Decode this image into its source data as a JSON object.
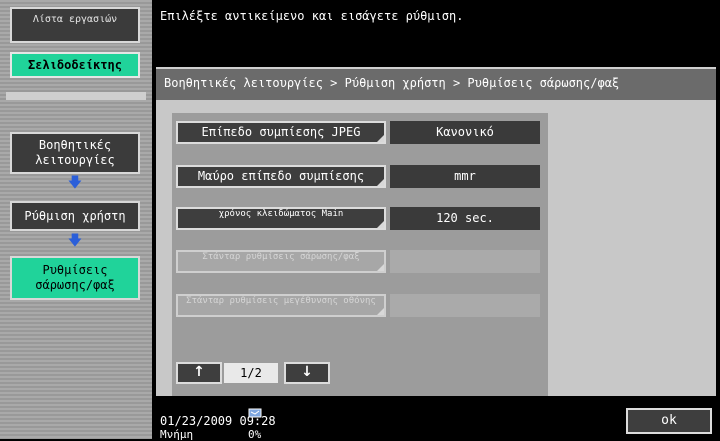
{
  "left_panel": {
    "job_list_label": "Λίστα εργασιών",
    "bookmark_tab": "Σελιδοδείκτης",
    "breadcrumb": [
      {
        "label": "Βοηθητικές λειτουργίες"
      },
      {
        "label": "Ρύθμιση χρήστη"
      },
      {
        "label": "Ρυθμίσεις σάρωσης/φαξ"
      }
    ]
  },
  "header": {
    "message": "Επιλέξτε αντικείμενο και εισάγετε ρύθμιση.",
    "path": "Βοηθητικές λειτουργίες > Ρύθμιση χρήστη > Ρυθμίσεις σάρωσης/φαξ"
  },
  "settings": [
    {
      "label": "Επίπεδο συμπίεσης JPEG",
      "value": "Κανονικό",
      "enabled": true
    },
    {
      "label": "Μαύρο επίπεδο συμπίεσης",
      "value": "mmr",
      "enabled": true
    },
    {
      "label": "χρόνος κλειδώματος Main",
      "value": "120  sec.",
      "enabled": true
    },
    {
      "label": "Στάνταρ ρυθμίσεις σάρωσης/φαξ",
      "value": "",
      "enabled": false
    },
    {
      "label": "Στάνταρ ρυθμίσεις μεγέθυνσης οθόνης",
      "value": "",
      "enabled": false
    }
  ],
  "pagination": {
    "current": "1/2",
    "up_icon": "arrow-up-icon",
    "down_icon": "arrow-down-icon"
  },
  "footer": {
    "datetime": "01/23/2009   09:28",
    "memory_label": "Μνήμη",
    "memory_value": "0%",
    "ok_label": "ok"
  },
  "colors": {
    "accent": "#20d39a",
    "arrow": "#2b5fd9"
  }
}
